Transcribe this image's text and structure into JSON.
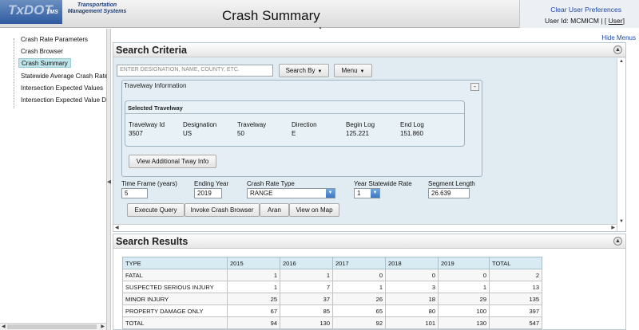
{
  "header": {
    "logo_text": "TxDOT",
    "logo_tms": "TMS",
    "logo_subtitle": "Transportation Management Systems",
    "title": "Crash Summary",
    "clear_prefs": "Clear User Preferences",
    "user_id_prefix": "User Id: MCMICM | [",
    "user_link": "User",
    "user_id_suffix": "]"
  },
  "nav": {
    "items": [
      {
        "label": "Crash Rate Parameters"
      },
      {
        "label": "Crash Browser"
      },
      {
        "label": "Crash Summary"
      },
      {
        "label": "Statewide Average Crash Rate"
      },
      {
        "label": "Intersection Expected Values"
      },
      {
        "label": "Intersection Expected Value D"
      }
    ]
  },
  "main": {
    "hide_menus": "Hide Menus",
    "criteria": {
      "title": "Search Criteria",
      "search_placeholder": "ENTER DESIGNATION, NAME, COUNTY, ETC.",
      "search_by_label": "Search By",
      "menu_label": "Menu",
      "travelway_info_title": "Travelway Information",
      "selected_travelway_title": "Selected Travelway",
      "travelway_fields": [
        {
          "label": "Travelway Id",
          "value": "3507"
        },
        {
          "label": "Designation",
          "value": "US"
        },
        {
          "label": "Travelway",
          "value": "50"
        },
        {
          "label": "Direction",
          "value": "E"
        },
        {
          "label": "Begin Log",
          "value": "125.221"
        },
        {
          "label": "End Log",
          "value": "151.860"
        }
      ],
      "view_tway_button": "View Additional Tway Info",
      "time_frame_label": "Time Frame (years)",
      "time_frame_value": "5",
      "ending_year_label": "Ending Year",
      "ending_year_value": "2019",
      "crash_rate_type_label": "Crash Rate Type",
      "crash_rate_type_value": "RANGE",
      "year_statewide_label": "Year Statewide Rate",
      "year_statewide_value": "1",
      "segment_length_label": "Segment Length",
      "segment_length_value": "26.639",
      "buttons": {
        "execute": "Execute Query",
        "invoke": "Invoke Crash Browser",
        "aran": "Aran",
        "view_map": "View on Map"
      }
    },
    "results": {
      "title": "Search Results",
      "columns": [
        "TYPE",
        "2015",
        "2016",
        "2017",
        "2018",
        "2019",
        "TOTAL"
      ],
      "rows": [
        {
          "type": "FATAL",
          "values": [
            "1",
            "1",
            "0",
            "0",
            "0",
            "2"
          ]
        },
        {
          "type": "SUSPECTED SERIOUS INJURY",
          "values": [
            "1",
            "7",
            "1",
            "3",
            "1",
            "13"
          ]
        },
        {
          "type": "MINOR INJURY",
          "values": [
            "25",
            "37",
            "26",
            "18",
            "29",
            "135"
          ]
        },
        {
          "type": "PROPERTY DAMAGE ONLY",
          "values": [
            "67",
            "85",
            "65",
            "80",
            "100",
            "397"
          ]
        },
        {
          "type": "TOTAL",
          "values": [
            "94",
            "130",
            "92",
            "101",
            "130",
            "547"
          ]
        }
      ]
    }
  },
  "icons": {
    "collapse": "collapse-up-icon",
    "dropdown": "chevron-down-icon",
    "splitter": "arrow-left-icon"
  },
  "colors": {
    "link": "#1e49a8",
    "panel_bg": "#e1ecf2",
    "nav_active": "#bfe4ea",
    "table_header": "#d8eaf2"
  }
}
